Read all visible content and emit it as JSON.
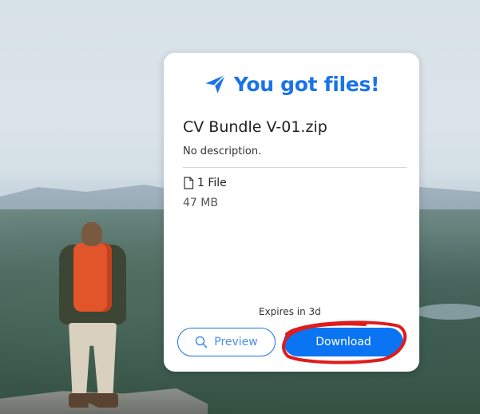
{
  "card": {
    "heading": "You got files!",
    "file_title": "CV Bundle V-01.zip",
    "description": "No description.",
    "file_count": "1 File",
    "file_size": "47 MB",
    "expires": "Expires in 3d",
    "preview_label": "Preview",
    "download_label": "Download"
  },
  "icons": {
    "heading_icon": "paper-plane-icon",
    "file_icon": "file-icon",
    "preview_icon": "search-icon"
  },
  "colors": {
    "accent": "#1a73e8",
    "download_bg": "#0b74f3",
    "annotation": "#e01b1b"
  }
}
